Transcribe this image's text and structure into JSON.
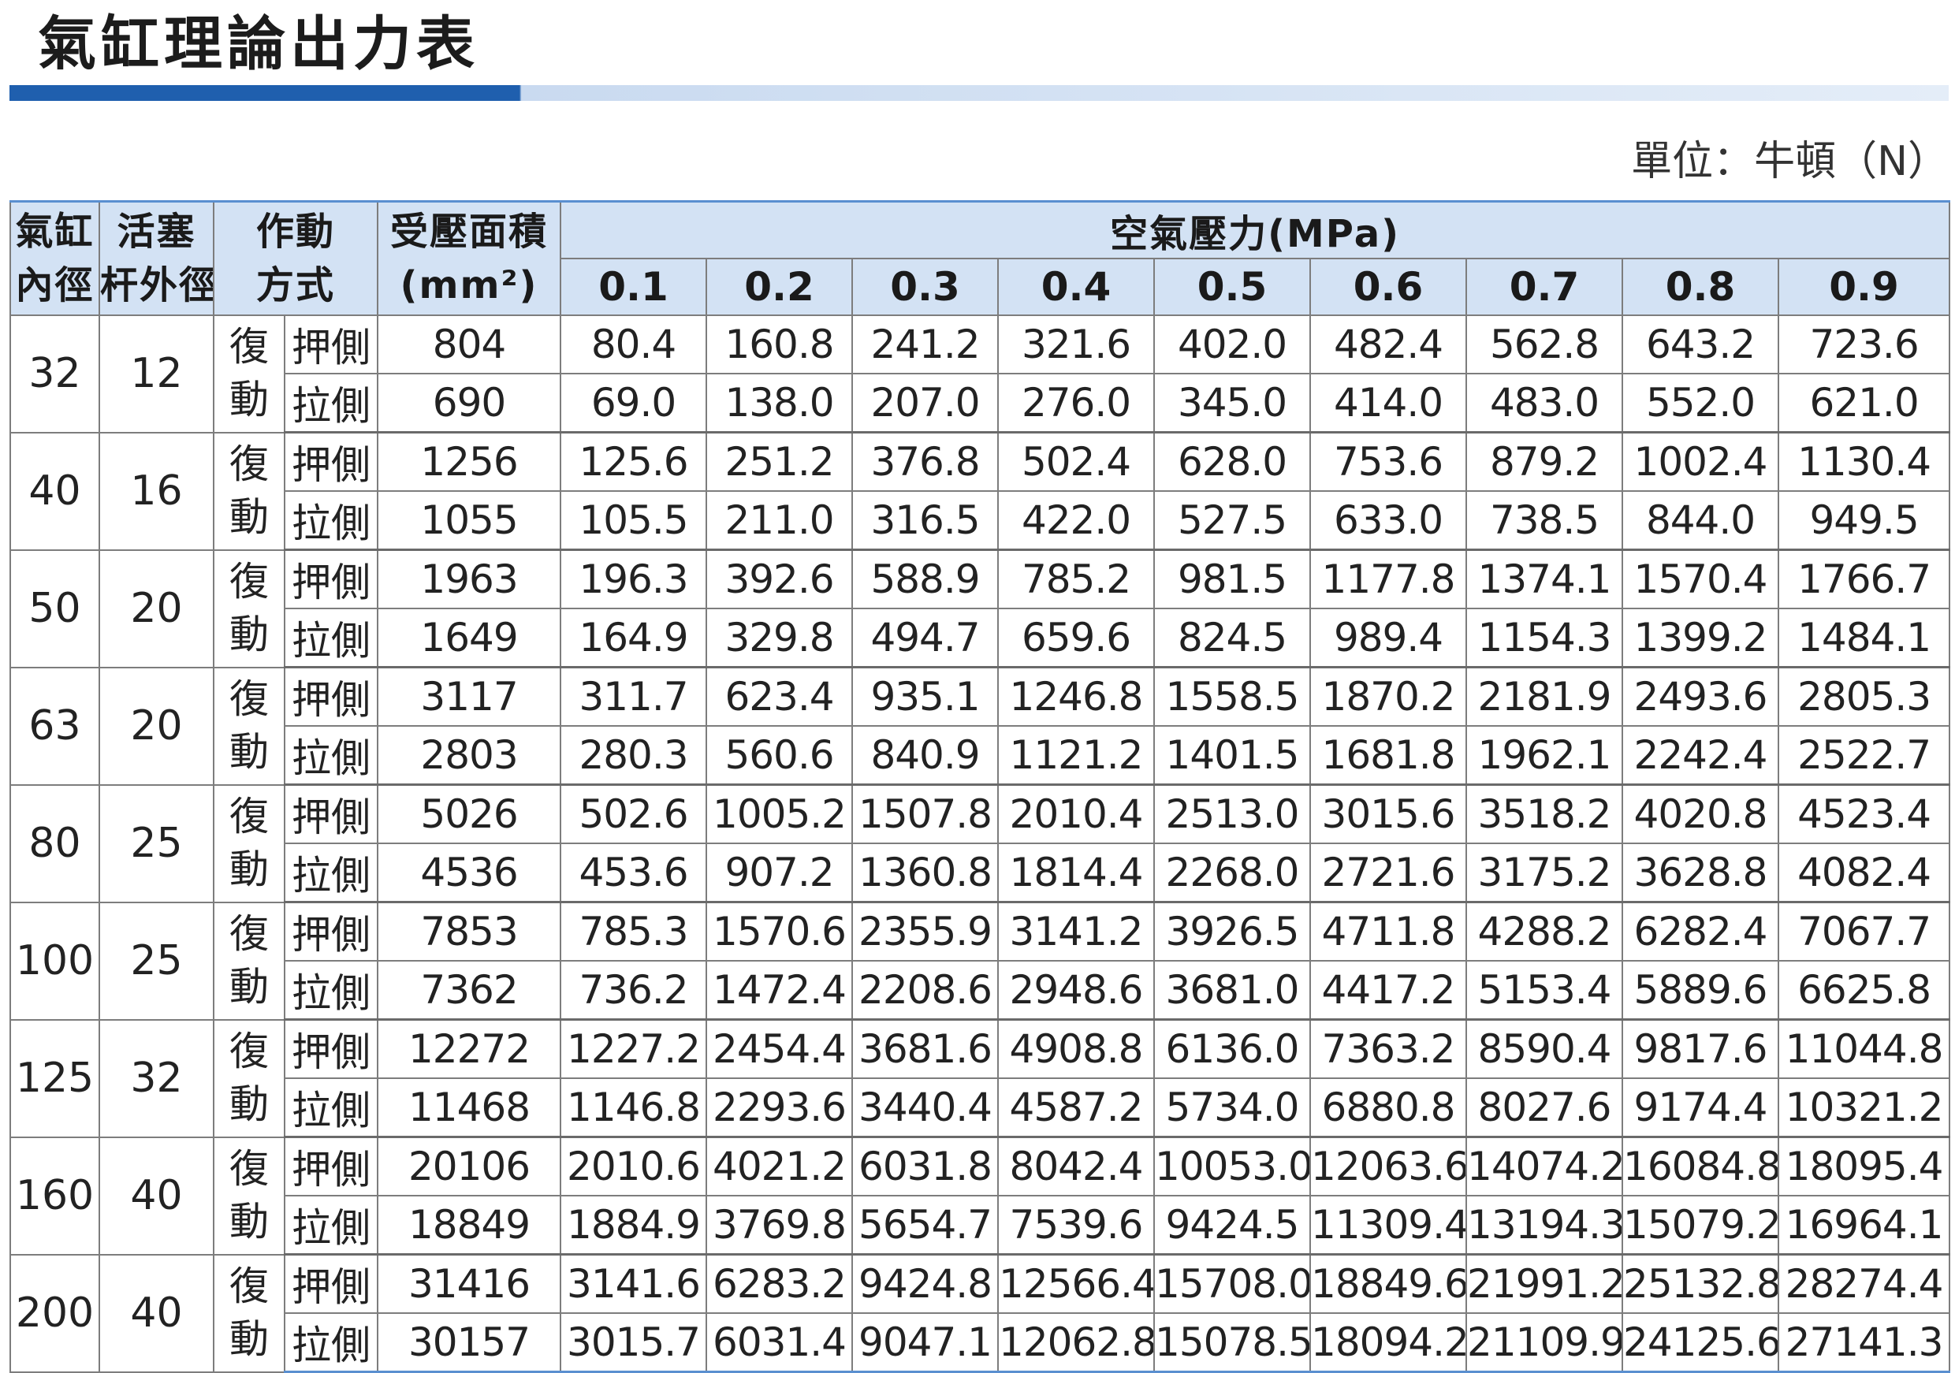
{
  "header": {
    "title": "氣缸理論出力表",
    "unit_label": "單位：牛頓（N）",
    "accent_color": "#1f5fae",
    "header_bg": "#d3e2f4"
  },
  "table": {
    "col_bore": [
      "氣缸",
      "內徑"
    ],
    "col_rod": [
      "活塞",
      "杆外徑"
    ],
    "col_action": [
      "作動",
      "方式"
    ],
    "col_area": [
      "受壓面積",
      "(mm²)"
    ],
    "col_pressure": "空氣壓力(MPa)",
    "pressures": [
      "0.1",
      "0.2",
      "0.3",
      "0.4",
      "0.5",
      "0.6",
      "0.7",
      "0.8",
      "0.9"
    ],
    "action_type": [
      "復",
      "動"
    ],
    "side_push": "押側",
    "side_pull": "拉側",
    "groups": [
      {
        "bore": "32",
        "rod": "12",
        "push": {
          "area": "804",
          "values": [
            "80.4",
            "160.8",
            "241.2",
            "321.6",
            "402.0",
            "482.4",
            "562.8",
            "643.2",
            "723.6"
          ]
        },
        "pull": {
          "area": "690",
          "values": [
            "69.0",
            "138.0",
            "207.0",
            "276.0",
            "345.0",
            "414.0",
            "483.0",
            "552.0",
            "621.0"
          ]
        }
      },
      {
        "bore": "40",
        "rod": "16",
        "push": {
          "area": "1256",
          "values": [
            "125.6",
            "251.2",
            "376.8",
            "502.4",
            "628.0",
            "753.6",
            "879.2",
            "1002.4",
            "1130.4"
          ]
        },
        "pull": {
          "area": "1055",
          "values": [
            "105.5",
            "211.0",
            "316.5",
            "422.0",
            "527.5",
            "633.0",
            "738.5",
            "844.0",
            "949.5"
          ]
        }
      },
      {
        "bore": "50",
        "rod": "20",
        "push": {
          "area": "1963",
          "values": [
            "196.3",
            "392.6",
            "588.9",
            "785.2",
            "981.5",
            "1177.8",
            "1374.1",
            "1570.4",
            "1766.7"
          ]
        },
        "pull": {
          "area": "1649",
          "values": [
            "164.9",
            "329.8",
            "494.7",
            "659.6",
            "824.5",
            "989.4",
            "1154.3",
            "1399.2",
            "1484.1"
          ]
        }
      },
      {
        "bore": "63",
        "rod": "20",
        "push": {
          "area": "3117",
          "values": [
            "311.7",
            "623.4",
            "935.1",
            "1246.8",
            "1558.5",
            "1870.2",
            "2181.9",
            "2493.6",
            "2805.3"
          ]
        },
        "pull": {
          "area": "2803",
          "values": [
            "280.3",
            "560.6",
            "840.9",
            "1121.2",
            "1401.5",
            "1681.8",
            "1962.1",
            "2242.4",
            "2522.7"
          ]
        }
      },
      {
        "bore": "80",
        "rod": "25",
        "push": {
          "area": "5026",
          "values": [
            "502.6",
            "1005.2",
            "1507.8",
            "2010.4",
            "2513.0",
            "3015.6",
            "3518.2",
            "4020.8",
            "4523.4"
          ]
        },
        "pull": {
          "area": "4536",
          "values": [
            "453.6",
            "907.2",
            "1360.8",
            "1814.4",
            "2268.0",
            "2721.6",
            "3175.2",
            "3628.8",
            "4082.4"
          ]
        }
      },
      {
        "bore": "100",
        "rod": "25",
        "push": {
          "area": "7853",
          "values": [
            "785.3",
            "1570.6",
            "2355.9",
            "3141.2",
            "3926.5",
            "4711.8",
            "4288.2",
            "6282.4",
            "7067.7"
          ]
        },
        "pull": {
          "area": "7362",
          "values": [
            "736.2",
            "1472.4",
            "2208.6",
            "2948.6",
            "3681.0",
            "4417.2",
            "5153.4",
            "5889.6",
            "6625.8"
          ]
        }
      },
      {
        "bore": "125",
        "rod": "32",
        "push": {
          "area": "12272",
          "values": [
            "1227.2",
            "2454.4",
            "3681.6",
            "4908.8",
            "6136.0",
            "7363.2",
            "8590.4",
            "9817.6",
            "11044.8"
          ]
        },
        "pull": {
          "area": "11468",
          "values": [
            "1146.8",
            "2293.6",
            "3440.4",
            "4587.2",
            "5734.0",
            "6880.8",
            "8027.6",
            "9174.4",
            "10321.2"
          ]
        }
      },
      {
        "bore": "160",
        "rod": "40",
        "push": {
          "area": "20106",
          "values": [
            "2010.6",
            "4021.2",
            "6031.8",
            "8042.4",
            "10053.0",
            "12063.6",
            "14074.2",
            "16084.8",
            "18095.4"
          ]
        },
        "pull": {
          "area": "18849",
          "values": [
            "1884.9",
            "3769.8",
            "5654.7",
            "7539.6",
            "9424.5",
            "11309.4",
            "13194.3",
            "15079.2",
            "16964.1"
          ]
        }
      },
      {
        "bore": "200",
        "rod": "40",
        "push": {
          "area": "31416",
          "values": [
            "3141.6",
            "6283.2",
            "9424.8",
            "12566.4",
            "15708.0",
            "18849.6",
            "21991.2",
            "25132.8",
            "28274.4"
          ]
        },
        "pull": {
          "area": "30157",
          "values": [
            "3015.7",
            "6031.4",
            "9047.1",
            "12062.8",
            "15078.5",
            "18094.2",
            "21109.9",
            "24125.6",
            "27141.3"
          ]
        }
      }
    ]
  }
}
